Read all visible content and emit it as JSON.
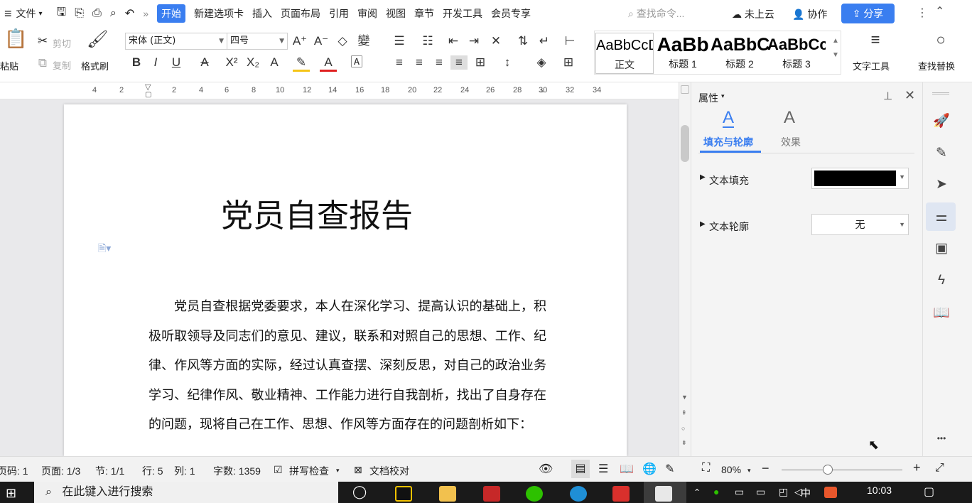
{
  "menu": {
    "hamburger": "≡",
    "file": "文件",
    "tabs": [
      "开始",
      "新建选项卡",
      "插入",
      "页面布局",
      "引用",
      "审阅",
      "视图",
      "章节",
      "开发工具",
      "会员专享"
    ],
    "search_placeholder": "查找命令...",
    "cloud": "未上云",
    "collab": "协作",
    "share": "分享"
  },
  "ribbon": {
    "paste": "粘贴",
    "cut": "剪切",
    "copy": "复制",
    "format_painter": "格式刷",
    "font_name": "宋体 (正文)",
    "font_size": "四号",
    "styles": [
      {
        "preview": "AaBbCcDd",
        "name": "正文"
      },
      {
        "preview": "AaBb",
        "name": "标题 1"
      },
      {
        "preview": "AaBbC",
        "name": "标题 2"
      },
      {
        "preview": "AaBbCc",
        "name": "标题 3"
      }
    ],
    "text_tools": "文字工具",
    "find_replace": "查找替换"
  },
  "ruler": {
    "ticks": [
      "4",
      "2",
      "2",
      "4",
      "6",
      "8",
      "10",
      "12",
      "14",
      "16",
      "18",
      "20",
      "22",
      "24",
      "26",
      "28",
      "30",
      "32",
      "34"
    ]
  },
  "document": {
    "title": "党员自查报告",
    "paragraph": "党员自查根据党委要求，本人在深化学习、提高认识的基础上，积极听取领导及同志们的意见、建议，联系和对照自己的思想、工作、纪律、作风等方面的实际，经过认真查摆、深刻反思，对自己的政治业务学习、纪律作风、敬业精神、工作能力进行自我剖析，找出了自身存在的问题，现将自己在工作、思想、作风等方面存在的问题剖析如下："
  },
  "panel": {
    "title": "属性",
    "tab_fill": "填充与轮廓",
    "tab_effect": "效果",
    "fill_label": "文本填充",
    "fill_color": "#000000",
    "outline_label": "文本轮廓",
    "outline_value": "无"
  },
  "sidebar": {
    "more": "•••"
  },
  "status": {
    "page_code": "页码: 1",
    "page": "页面: 1/3",
    "section": "节: 1/1",
    "row": "行: 5",
    "col": "列: 1",
    "word_count": "字数: 1359",
    "spell_check": "拼写检查",
    "doc_proof": "文档校对",
    "zoom": "80%"
  },
  "taskbar": {
    "search_placeholder": "在此键入进行搜索",
    "time": "10:03",
    "ime": "中"
  },
  "colors": {
    "accent": "#3a7ef0",
    "highlight": "#f5c518",
    "font_color": "#e02020",
    "wps_red": "#d9302c"
  }
}
